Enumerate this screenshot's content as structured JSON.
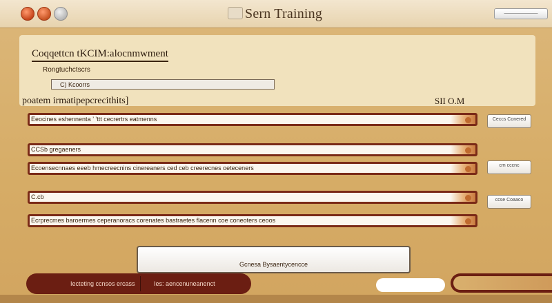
{
  "window": {
    "title": "Sern Training",
    "titlebar_button": "———————"
  },
  "panel": {
    "heading": "Coqqettcn tKCIM:alocnmwment",
    "subheading": "Rongtuchctscrs",
    "combo_value": "C) Kcoorrs"
  },
  "section": {
    "label": "poatem irmatipepcrecithits]",
    "value": "SII O.M"
  },
  "rows": [
    {
      "text": "Eeocines eshennenta  ’  ’ttt cecrertrs eatmenns"
    },
    {
      "text": "CCSb gregaeners"
    },
    {
      "text": "Ecoensecnnaes eeeb hmecreecnins cinereaners ced ceb creerecnes oeteceners"
    },
    {
      "text": "C.cb"
    },
    {
      "text": "Ecrprecmes baroermes ceperanoracs corenates bastraetes flacenn coe coneoters ceoos"
    }
  ],
  "side_buttons": [
    {
      "label": "Ceccs Conered"
    },
    {
      "label": "cm cccnc"
    },
    {
      "label": "ccse Coaaco"
    }
  ],
  "center_button": {
    "label": "Gcnesa Bysaentycencce"
  },
  "bottom_bar": {
    "segment1": "Iecteting ccnsos ercass",
    "segment2": "Ies: aencenuneanenct"
  },
  "colors": {
    "background": "#d9b06e",
    "accent_dark": "#7a2a17",
    "panel": "#f1e2bd"
  }
}
